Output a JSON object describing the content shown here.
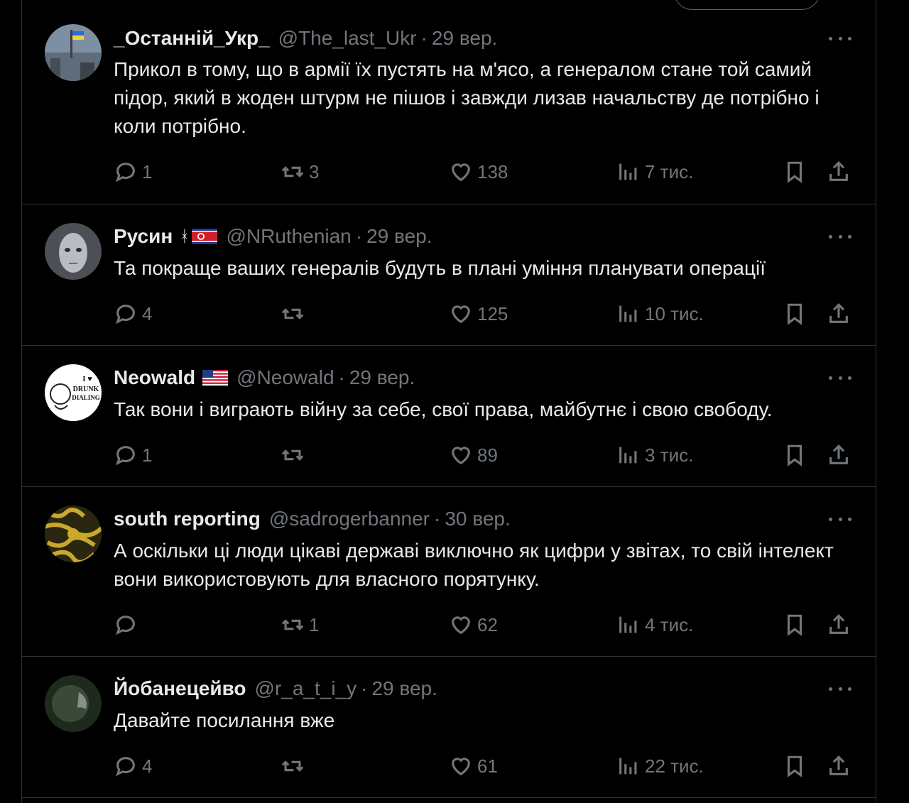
{
  "tweets": [
    {
      "name": "_Останній_Укр_",
      "handle": "@The_last_Ukr",
      "sep": "·",
      "date": "29 вер.",
      "text": "Прикол в тому, що в армії їх пустять на м'ясо, а генералом стане той самий підор, який в жоден штурм не пішов і завжди лизав начальству де потрібно і коли потрібно.",
      "replies": "1",
      "retweets": "3",
      "likes": "138",
      "views": "7 тис.",
      "avatar": "ukraine-flag-city-photo"
    },
    {
      "name": "Русин",
      "flags": "north-korea-flag",
      "handle": "@NRuthenian",
      "sep": "·",
      "date": "29 вер.",
      "text": "Та покраще ваших генералів будуть в плані уміння планувати операції",
      "replies": "4",
      "retweets": "",
      "likes": "125",
      "views": "10 тис.",
      "avatar": "pale-face-portrait"
    },
    {
      "name": "Neowald",
      "flags": "usa-flag",
      "handle": "@Neowald",
      "sep": "·",
      "date": "29 вер.",
      "text": "Так вони і виграють війну за себе, свої права, майбутнє і свою свободу.",
      "replies": "1",
      "retweets": "",
      "likes": "89",
      "views": "3 тис.",
      "avatar": "i-love-drunk-dialing-logo",
      "avatar_text": [
        "I ♥",
        "DRUNK",
        "DIALING"
      ]
    },
    {
      "name": "south reporting",
      "handle": "@sadrogerbanner",
      "sep": "·",
      "date": "30 вер.",
      "text": "А оскільки ці люди цікаві державі виключно як цифри у звітах, то свій інтелект вони використовують для власного порятунку.",
      "replies": "",
      "retweets": "1",
      "likes": "62",
      "views": "4 тис.",
      "avatar": "yellow-black-pattern"
    },
    {
      "name": "Йобанецейво",
      "handle": "@r_a_t_i_y",
      "sep": "·",
      "date": "29 вер.",
      "text": "Давайте посилання вже",
      "replies": "4",
      "retweets": "",
      "likes": "61",
      "views": "22 тис.",
      "avatar": "dark-green-photo"
    }
  ],
  "colors": {
    "background": "#000000",
    "text": "#e7e9ea",
    "muted": "#71767b",
    "border": "#2f3336"
  }
}
